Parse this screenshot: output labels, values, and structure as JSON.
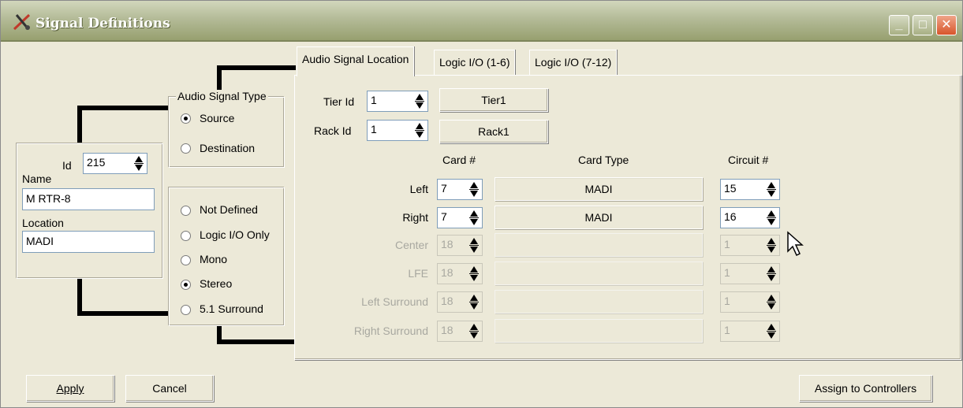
{
  "window": {
    "title": "Signal Definitions",
    "icon": "signal-definitions-app-icon",
    "minimize_icon": "minimize-icon",
    "maximize_icon": "maximize-icon",
    "close_icon": "close-icon"
  },
  "identity": {
    "id_label": "Id",
    "id_value": "215",
    "name_label": "Name",
    "name_value": "M RTR-8",
    "location_label": "Location",
    "location_value": "MADI"
  },
  "signal_type": {
    "legend": "Audio Signal Type",
    "options": [
      "Source",
      "Destination"
    ],
    "selected": "Source"
  },
  "format": {
    "options": [
      "Not Defined",
      "Logic I/O Only",
      "Mono",
      "Stereo",
      "5.1 Surround"
    ],
    "selected": "Stereo"
  },
  "tabs": [
    {
      "label": "Audio Signal Location",
      "active": true
    },
    {
      "label": "Logic I/O (1-6)",
      "active": false
    },
    {
      "label": "Logic I/O (7-12)",
      "active": false
    }
  ],
  "location": {
    "tier_label": "Tier Id",
    "tier_value": "1",
    "tier_name": "Tier1",
    "rack_label": "Rack Id",
    "rack_value": "1",
    "rack_name": "Rack1",
    "col_card": "Card #",
    "col_card_type": "Card Type",
    "col_circuit": "Circuit #",
    "rows": [
      {
        "label": "Left",
        "card": "7",
        "card_type": "MADI",
        "circuit": "15",
        "enabled": true
      },
      {
        "label": "Right",
        "card": "7",
        "card_type": "MADI",
        "circuit": "16",
        "enabled": true
      },
      {
        "label": "Center",
        "card": "18",
        "card_type": "",
        "circuit": "1",
        "enabled": false
      },
      {
        "label": "LFE",
        "card": "18",
        "card_type": "",
        "circuit": "1",
        "enabled": false
      },
      {
        "label": "Left Surround",
        "card": "18",
        "card_type": "",
        "circuit": "1",
        "enabled": false
      },
      {
        "label": "Right Surround",
        "card": "18",
        "card_type": "",
        "circuit": "1",
        "enabled": false
      }
    ]
  },
  "footer": {
    "apply_label": "Apply",
    "cancel_label": "Cancel",
    "assign_label": "Assign to Controllers"
  }
}
